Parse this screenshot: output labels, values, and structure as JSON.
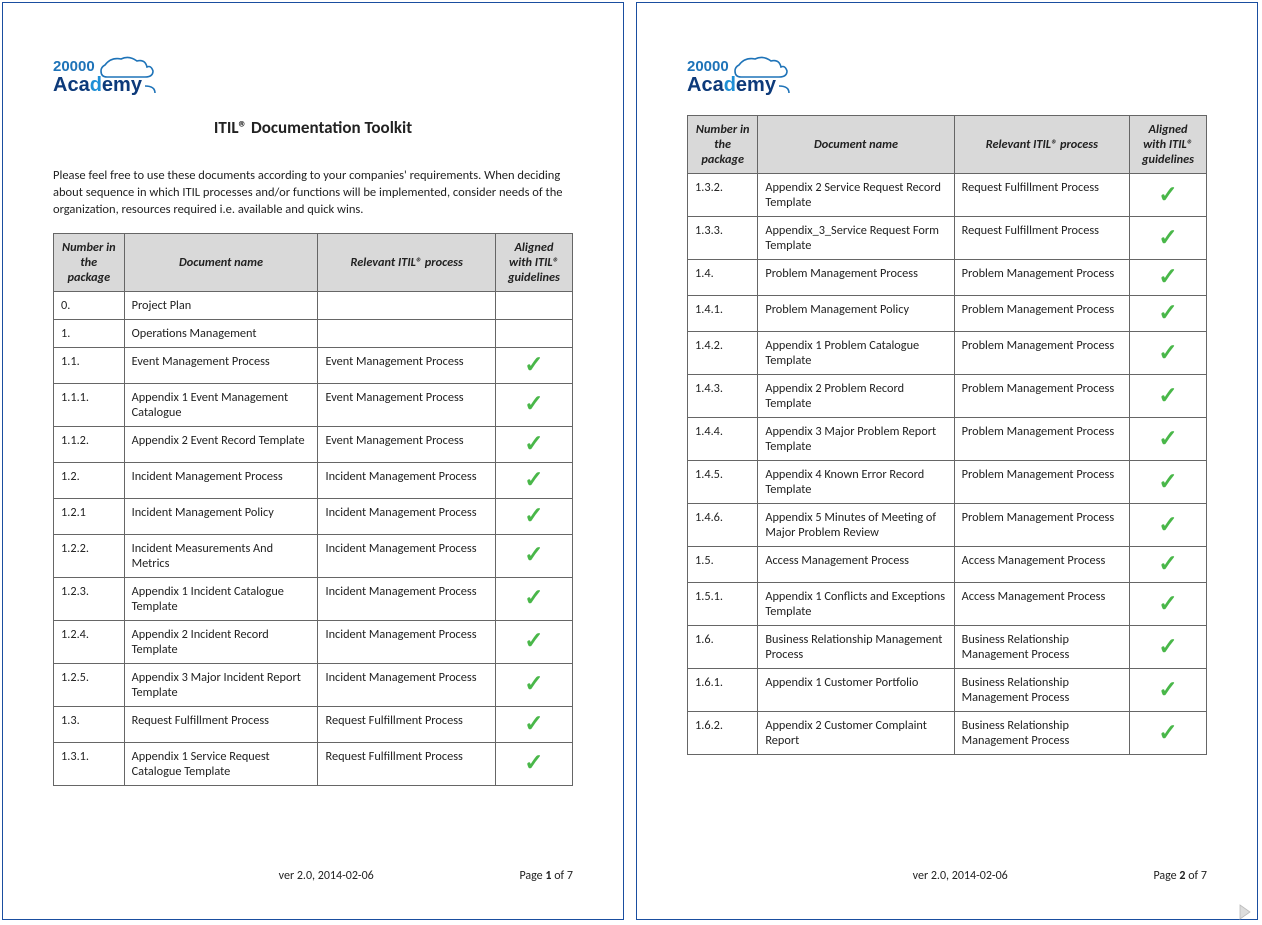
{
  "brand": {
    "top": "20000",
    "bottom": "Academy"
  },
  "title": "ITIL® Documentation Toolkit",
  "intro": "Please feel free to use these documents according to your companies' requirements. When deciding about sequence in which ITIL processes and/or functions will be implemented, consider needs of the organization, resources required i.e. available and quick wins.",
  "columns": {
    "num": "Number in the package",
    "doc": "Document name",
    "proc": "Relevant ITIL® process",
    "align": "Aligned with ITIL® guidelines"
  },
  "footer": {
    "version": "ver  2.0, 2014-02-06",
    "page_label": "Page",
    "of_label": "of",
    "total": "7"
  },
  "pages": [
    {
      "page_num": "1",
      "rows": [
        {
          "num": "0.",
          "doc": "Project Plan",
          "proc": "",
          "check": false
        },
        {
          "num": "1.",
          "doc": "Operations Management",
          "proc": "",
          "check": false
        },
        {
          "num": "1.1.",
          "doc": "Event Management Process",
          "proc": "Event Management Process",
          "check": true
        },
        {
          "num": "1.1.1.",
          "doc": "Appendix 1 Event Management Catalogue",
          "proc": "Event Management Process",
          "check": true
        },
        {
          "num": "1.1.2.",
          "doc": "Appendix 2 Event Record Template",
          "proc": "Event Management Process",
          "check": true
        },
        {
          "num": "1.2.",
          "doc": "Incident Management Process",
          "proc": "Incident Management Process",
          "check": true
        },
        {
          "num": "1.2.1",
          "doc": "Incident Management Policy",
          "proc": "Incident Management Process",
          "check": true
        },
        {
          "num": "1.2.2.",
          "doc": "Incident Measurements And Metrics",
          "proc": "Incident Management Process",
          "check": true
        },
        {
          "num": "1.2.3.",
          "doc": "Appendix 1 Incident Catalogue Template",
          "proc": "Incident Management Process",
          "check": true
        },
        {
          "num": "1.2.4.",
          "doc": "Appendix 2 Incident Record Template",
          "proc": "Incident Management Process",
          "check": true
        },
        {
          "num": "1.2.5.",
          "doc": "Appendix 3 Major Incident Report Template",
          "proc": "Incident Management Process",
          "check": true
        },
        {
          "num": "1.3.",
          "doc": "Request Fulfillment Process",
          "proc": "Request Fulfillment Process",
          "check": true
        },
        {
          "num": "1.3.1.",
          "doc": "Appendix 1 Service Request Catalogue Template",
          "proc": "Request Fulfillment Process",
          "check": true
        }
      ]
    },
    {
      "page_num": "2",
      "rows": [
        {
          "num": "1.3.2.",
          "doc": "Appendix 2 Service Request Record Template",
          "proc": "Request Fulfillment Process",
          "check": true
        },
        {
          "num": "1.3.3.",
          "doc": "Appendix_3_Service Request Form Template",
          "proc": "Request Fulfillment Process",
          "check": true
        },
        {
          "num": "1.4.",
          "doc": "Problem Management Process",
          "proc": "Problem Management Process",
          "check": true
        },
        {
          "num": "1.4.1.",
          "doc": "Problem Management Policy",
          "proc": "Problem Management Process",
          "check": true
        },
        {
          "num": "1.4.2.",
          "doc": "Appendix 1 Problem Catalogue Template",
          "proc": "Problem Management Process",
          "check": true
        },
        {
          "num": "1.4.3.",
          "doc": "Appendix 2 Problem Record Template",
          "proc": "Problem Management Process",
          "check": true
        },
        {
          "num": "1.4.4.",
          "doc": "Appendix 3 Major Problem Report Template",
          "proc": "Problem Management Process",
          "check": true
        },
        {
          "num": "1.4.5.",
          "doc": "Appendix 4 Known Error Record Template",
          "proc": "Problem Management Process",
          "check": true
        },
        {
          "num": "1.4.6.",
          "doc": "Appendix 5 Minutes of Meeting of Major Problem Review",
          "proc": "Problem Management Process",
          "check": true
        },
        {
          "num": "1.5.",
          "doc": "Access Management Process",
          "proc": "Access Management Process",
          "check": true
        },
        {
          "num": "1.5.1.",
          "doc": "Appendix 1 Conflicts and Exceptions Template",
          "proc": "Access Management Process",
          "check": true
        },
        {
          "num": "1.6.",
          "doc": "Business Relationship Management Process",
          "proc": "Business Relationship Management Process",
          "check": true
        },
        {
          "num": "1.6.1.",
          "doc": "Appendix 1 Customer Portfolio",
          "proc": "Business Relationship Management Process",
          "check": true
        },
        {
          "num": "1.6.2.",
          "doc": "Appendix 2 Customer Complaint Report",
          "proc": "Business Relationship Management Process",
          "check": true
        }
      ]
    }
  ]
}
